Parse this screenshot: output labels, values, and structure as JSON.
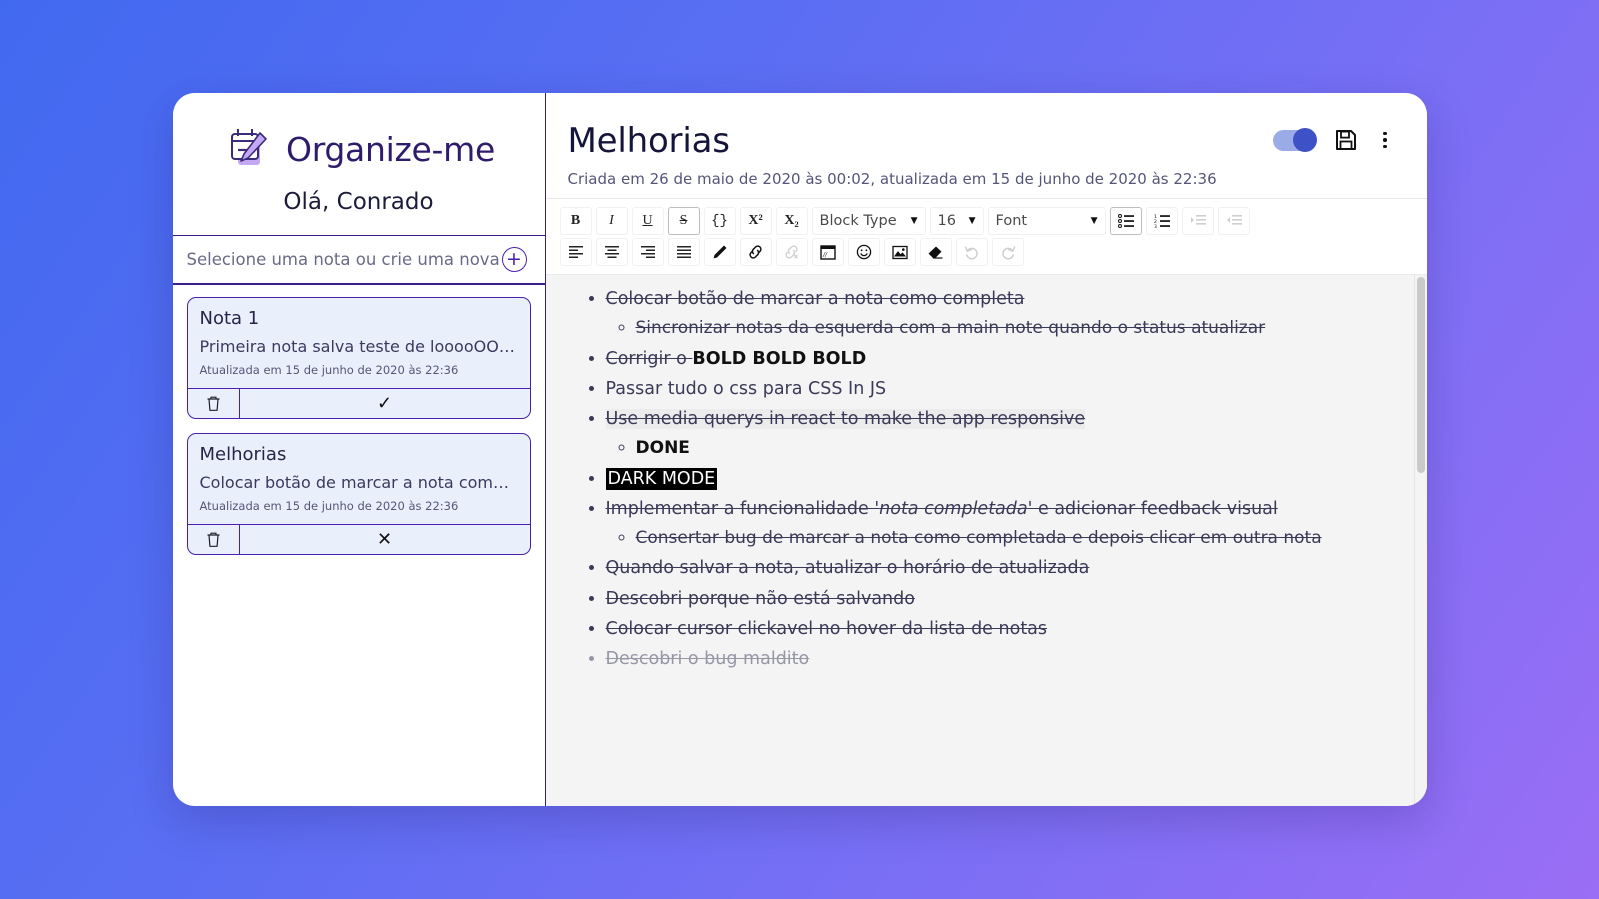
{
  "background": {
    "from": "#4169f0",
    "to": "#9a6ef5"
  },
  "sidebar": {
    "brand_title": "Organize-me",
    "brand_icon": "calendar-pencil-icon",
    "greeting": "Olá, Conrado",
    "search": {
      "placeholder": "Selecione uma nota ou crie uma nova",
      "value": "",
      "add_icon": "plus-circle-icon"
    },
    "notes": [
      {
        "title": "Nota 1",
        "snippet": "Primeira nota salva teste de looooOOOOOOOop V…",
        "date": "Atualizada em 15 de junho de 2020 às 22:36",
        "delete_icon": "trash-icon",
        "status_icon": "check-icon",
        "status_glyph": "✓"
      },
      {
        "title": "Melhorias",
        "snippet": "Colocar botão de marcar a nota como completa …",
        "date": "Atualizada em 15 de junho de 2020 às 22:36",
        "delete_icon": "trash-icon",
        "status_icon": "x-icon",
        "status_glyph": "✕"
      }
    ]
  },
  "main": {
    "note_title": "Melhorias",
    "note_meta": "Criada em 26 de maio de 2020 às 00:02, atualizada em 15 de junho de 2020 às 22:36",
    "toggle": {
      "name": "dark-mode-toggle",
      "state": "on",
      "on_color": "#3f51c7",
      "track_color": "#9aabe8"
    },
    "save_icon": "floppy-save-icon",
    "more_icon": "more-vertical-icon"
  },
  "toolbar": {
    "row1": [
      {
        "label": "B",
        "name": "bold-button",
        "style": "bold",
        "active": false
      },
      {
        "label": "I",
        "name": "italic-button",
        "style": "italic",
        "active": false
      },
      {
        "label": "U",
        "name": "underline-button",
        "style": "underline",
        "active": false
      },
      {
        "label": "S",
        "name": "strikethrough-button",
        "style": "strike",
        "active": true
      },
      {
        "label": "{}",
        "name": "monospace-button",
        "style": "plain",
        "active": false
      },
      {
        "label": "X²",
        "name": "superscript-button",
        "style": "sup",
        "active": false
      },
      {
        "label": "X₂",
        "name": "subscript-button",
        "style": "sub",
        "active": false
      }
    ],
    "block_type": {
      "label": "Block Type",
      "name": "block-type-select",
      "caret": "▼"
    },
    "font_size": {
      "label": "16",
      "name": "font-size-select",
      "caret": "▼"
    },
    "font_family": {
      "label": "Font",
      "name": "font-family-select",
      "caret": "▼"
    },
    "list_buttons": [
      {
        "name": "unordered-list-button",
        "icon": "bullet-list-icon",
        "active": true,
        "disabled": false
      },
      {
        "name": "ordered-list-button",
        "icon": "numbered-list-icon",
        "active": false,
        "disabled": false
      },
      {
        "name": "indent-button",
        "icon": "indent-icon",
        "active": false,
        "disabled": true
      },
      {
        "name": "outdent-button",
        "icon": "outdent-icon",
        "active": false,
        "disabled": true
      }
    ],
    "row2": [
      {
        "name": "align-left-button",
        "icon": "align-left-icon",
        "disabled": false
      },
      {
        "name": "align-center-button",
        "icon": "align-center-icon",
        "disabled": false
      },
      {
        "name": "align-right-button",
        "icon": "align-right-icon",
        "disabled": false
      },
      {
        "name": "align-justify-button",
        "icon": "align-justify-icon",
        "disabled": false
      },
      {
        "name": "text-color-button",
        "icon": "pencil-icon",
        "disabled": false
      },
      {
        "name": "insert-link-button",
        "icon": "link-icon",
        "disabled": false
      },
      {
        "name": "remove-link-button",
        "icon": "broken-link-icon",
        "disabled": true
      },
      {
        "name": "embed-button",
        "icon": "embedded-window-icon",
        "disabled": false
      },
      {
        "name": "emoji-button",
        "icon": "smiley-icon",
        "disabled": false
      },
      {
        "name": "image-button",
        "icon": "picture-icon",
        "disabled": false
      },
      {
        "name": "clear-format-button",
        "icon": "eraser-icon",
        "disabled": false
      },
      {
        "name": "undo-button",
        "icon": "undo-arrow-icon",
        "disabled": true
      },
      {
        "name": "redo-button",
        "icon": "redo-arrow-icon",
        "disabled": true
      }
    ]
  },
  "editor": {
    "items": [
      {
        "level": 1,
        "strike": true,
        "text": "Colocar botão de marcar a nota como completa"
      },
      {
        "level": 2,
        "strike": true,
        "text": "Sincronizar notas da esquerda com a main note quando o status atualizar"
      },
      {
        "level": 1,
        "strike": "partial",
        "text": "Corrigir o ",
        "bold_tail": "BOLD BOLD BOLD"
      },
      {
        "level": 1,
        "strike": false,
        "text": "Passar tudo o css para CSS In JS"
      },
      {
        "level": 1,
        "strike": true,
        "highlight": "grey",
        "text": "Use media querys in react to make the app responsive"
      },
      {
        "level": 2,
        "strike": false,
        "bold": true,
        "text": "DONE"
      },
      {
        "level": 1,
        "strike": false,
        "highlight": "black",
        "text": "DARK MODE"
      },
      {
        "level": 1,
        "strike": true,
        "text": "Implementar a funcionalidade '",
        "italic_mid": "nota completada",
        "text_tail": "' e adicionar feedback visual"
      },
      {
        "level": 2,
        "strike": true,
        "text": "Consertar bug de marcar a nota como completada e depois clicar em outra nota"
      },
      {
        "level": 1,
        "strike": true,
        "text": "Quando salvar a nota, atualizar o horário de atualizada"
      },
      {
        "level": 1,
        "strike": true,
        "text": "Descobri porque não está salvando"
      },
      {
        "level": 1,
        "strike": true,
        "text": "Colocar cursor clickavel no hover da lista de notas"
      },
      {
        "level": 1,
        "strike": true,
        "partial_cut": true,
        "text": "Descobri o bug maldito"
      }
    ],
    "scrollbar": {
      "name": "editor-scrollbar",
      "position": "top"
    }
  }
}
